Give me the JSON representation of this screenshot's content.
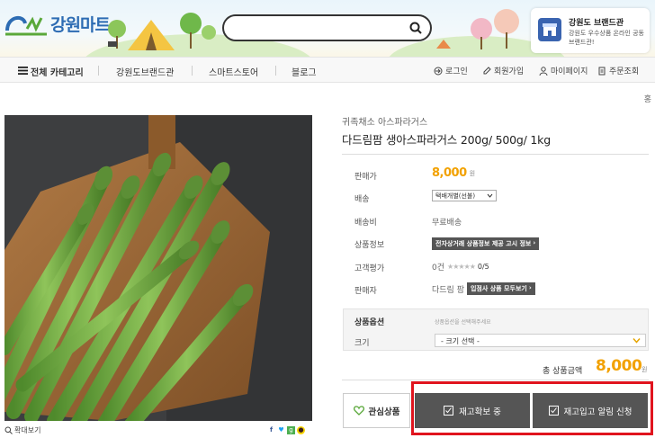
{
  "header": {
    "logo_text": "강원마트",
    "search_placeholder": "",
    "brand_box": {
      "title": "강원도 브랜드관",
      "subtitle": "강원도 우수상품 온라인 공동 브랜드관!"
    }
  },
  "nav": {
    "all_categories": "전체 카테고리",
    "menus": [
      "강원도브랜드관",
      "스마트스토어",
      "블로그"
    ],
    "utils": [
      "로그인",
      "회원가입",
      "마이페이지",
      "주문조회"
    ]
  },
  "corner_text": "홍",
  "product": {
    "category": "귀족채소 아스파라거스",
    "name": "다드림팜 생아스파라거스 200g/ 500g/ 1kg",
    "rows": {
      "price_label": "판매가",
      "price": "8,000",
      "price_unit": "원",
      "shipping_label": "배송",
      "shipping_option": "택배개별(선불)",
      "shipping_fee_label": "배송비",
      "shipping_fee": "무료배송",
      "info_label": "상품정보",
      "info_tag": "전자상거래 상품정보 제공 고시 정보",
      "rating_label": "고객평가",
      "rating_count": "0건",
      "rating_stars": "★★★★★",
      "rating_score": "0/5",
      "seller_label": "판매자",
      "seller": "다드림 팜",
      "seller_tag": "입점사 상품 모두보기"
    },
    "options": {
      "title": "상품옵션",
      "hint": "상품옵션을 선택해주세요",
      "size_label": "크기",
      "size_selected": "- 크기 선택 -"
    },
    "total_label": "총 상품금액",
    "total_price": "8,000",
    "total_unit": "원",
    "zoom_label": "확대보기"
  },
  "buttons": {
    "wish": "관심상품",
    "stock_checking": "재고확보 중",
    "restock_alert": "재고입고 알림 신청"
  },
  "colors": {
    "accent_price": "#f2a100",
    "button_dark": "#555555",
    "highlight_border": "#e0141e",
    "logo_blue": "#2d6cb3"
  }
}
